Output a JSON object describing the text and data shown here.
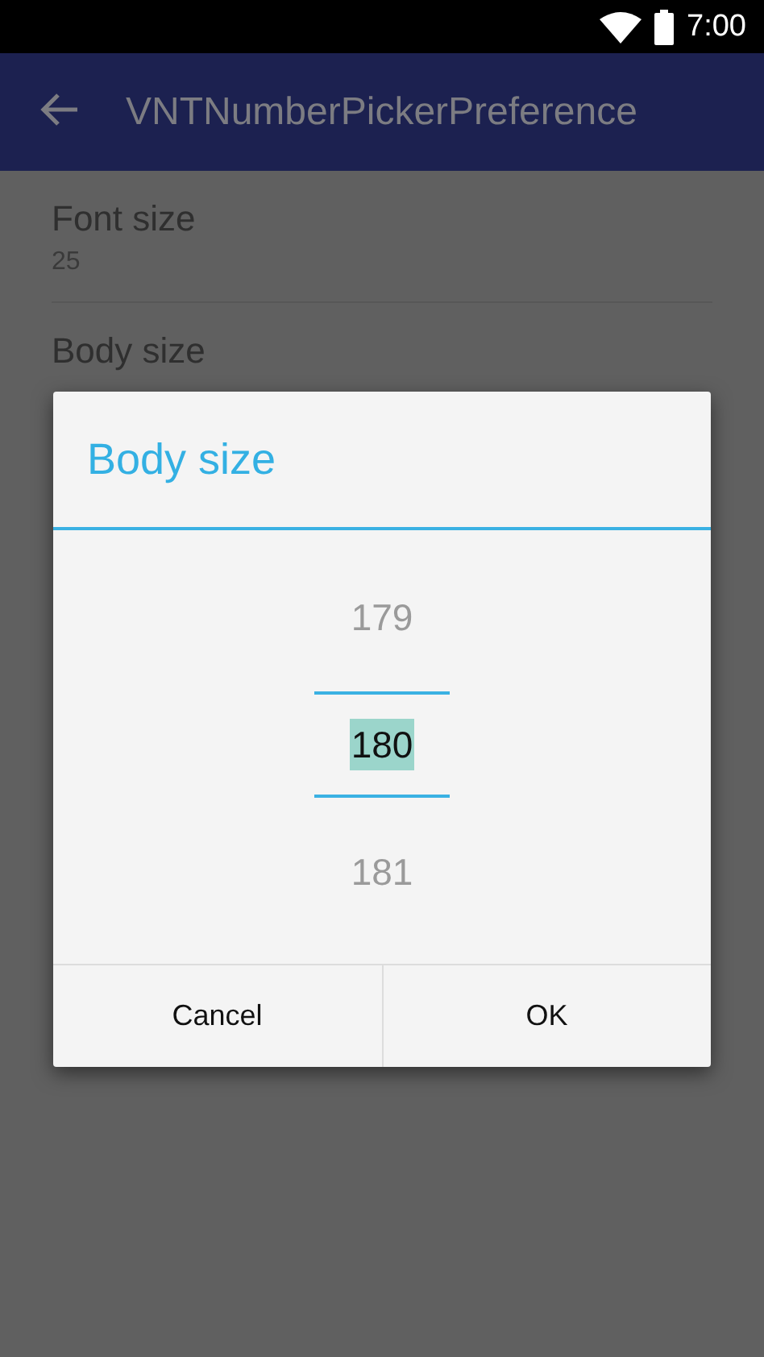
{
  "status_bar": {
    "time": "7:00"
  },
  "app_bar": {
    "title": "VNTNumberPickerPreference"
  },
  "preferences": [
    {
      "title": "Font size",
      "summary": "25"
    },
    {
      "title": "Body size"
    }
  ],
  "dialog": {
    "title": "Body size",
    "picker": [
      {
        "value": "179",
        "selected": false
      },
      {
        "value": "180",
        "selected": true
      },
      {
        "value": "181",
        "selected": false
      }
    ],
    "buttons": [
      "Cancel",
      "OK"
    ]
  }
}
